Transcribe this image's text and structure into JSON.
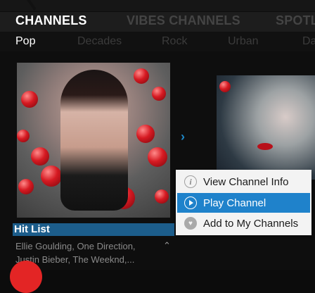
{
  "tabs": [
    {
      "label": "CHANNELS"
    },
    {
      "label": "VIBES CHANNELS"
    },
    {
      "label": "SPOTL"
    }
  ],
  "genres": [
    {
      "label": "Pop"
    },
    {
      "label": "Decades"
    },
    {
      "label": "Rock"
    },
    {
      "label": "Urban"
    },
    {
      "label": "Da"
    }
  ],
  "channel": {
    "title": "Hit List",
    "description_line1": "Ellie Goulding, One Direction,",
    "description_line2": "Justin Bieber, The Weeknd,..."
  },
  "context_menu": {
    "items": [
      {
        "label": "View Channel Info",
        "icon": "info-icon"
      },
      {
        "label": "Play Channel",
        "icon": "play-icon"
      },
      {
        "label": "Add to My Channels",
        "icon": "heart-icon"
      }
    ]
  },
  "colors": {
    "accent": "#1f82cb",
    "label_bg": "#1c5d8b",
    "badge": "#e32525"
  }
}
